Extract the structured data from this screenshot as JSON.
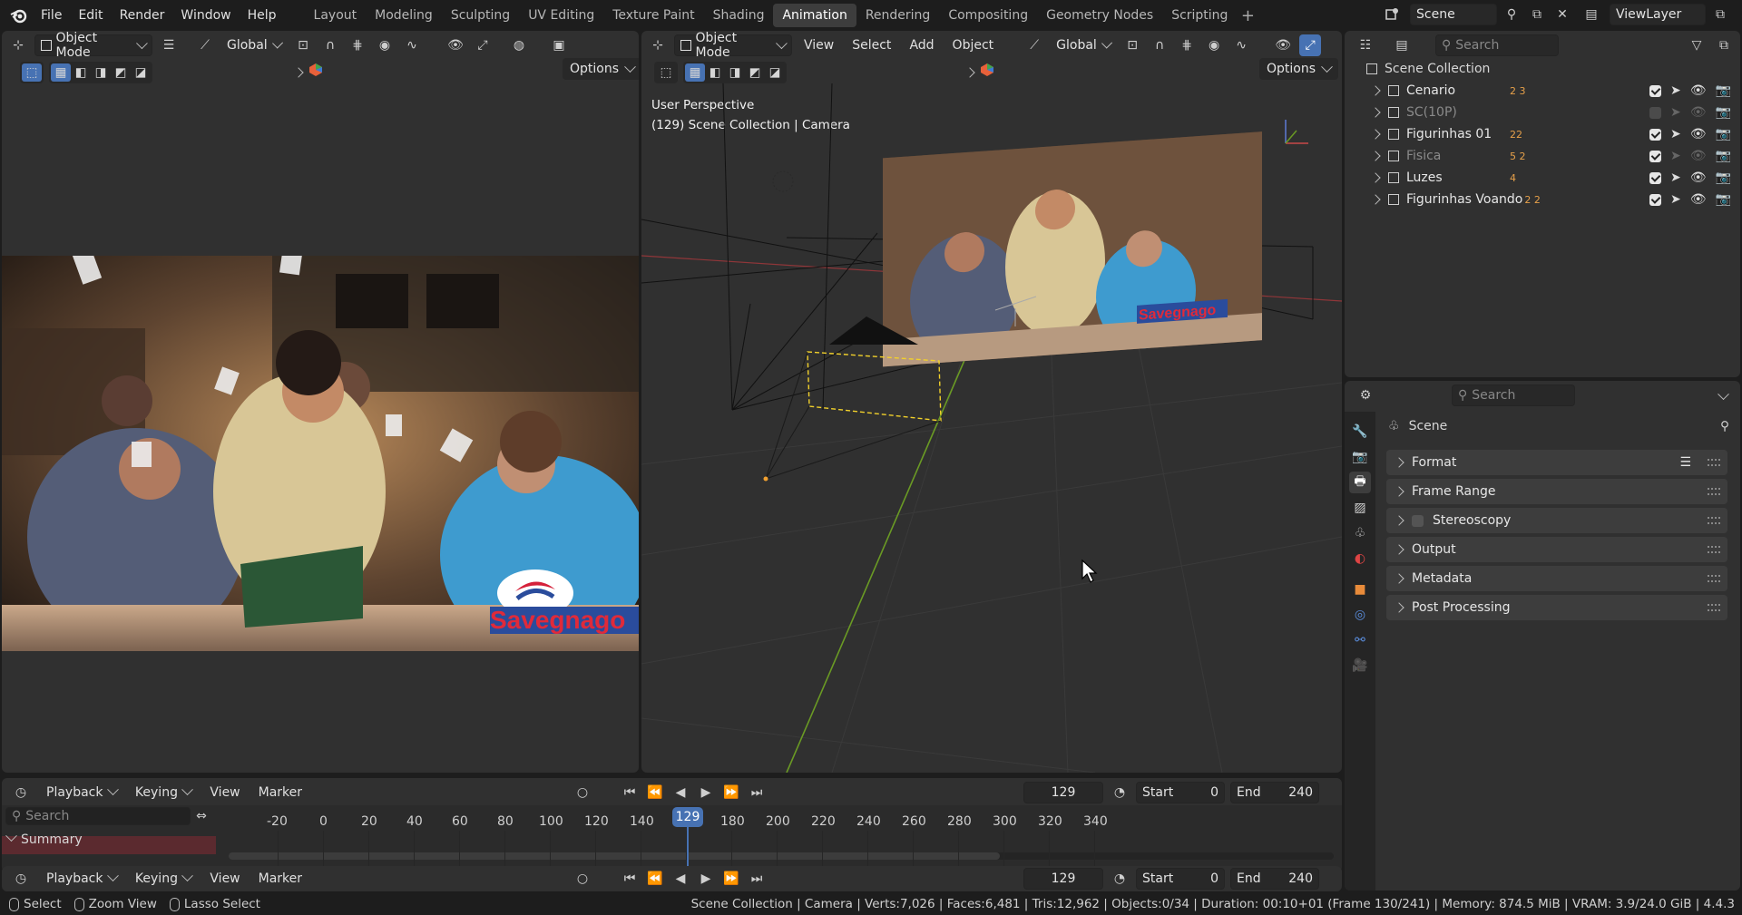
{
  "top_menu": [
    "File",
    "Edit",
    "Render",
    "Window",
    "Help"
  ],
  "workspaces": [
    "Layout",
    "Modeling",
    "Sculpting",
    "UV Editing",
    "Texture Paint",
    "Shading",
    "Animation",
    "Rendering",
    "Compositing",
    "Geometry Nodes",
    "Scripting"
  ],
  "active_workspace": "Animation",
  "scene_name": "Scene",
  "view_layer": "ViewLayer",
  "left_viewport": {
    "mode": "Object Mode",
    "orientation": "Global",
    "options_label": "Options",
    "watermark": "Savegnago"
  },
  "main_viewport": {
    "mode": "Object Mode",
    "menus": [
      "View",
      "Select",
      "Add",
      "Object"
    ],
    "orientation": "Global",
    "options_label": "Options",
    "overlay_line1": "User Perspective",
    "overlay_line2": "(129) Scene Collection | Camera",
    "watermark": "Savegnago"
  },
  "outliner": {
    "search_placeholder": "Search",
    "root": "Scene Collection",
    "items": [
      {
        "name": "Cenario",
        "badge": "2 3",
        "enabled": true,
        "visible": true
      },
      {
        "name": "SC(10P)",
        "badge": "",
        "enabled": false,
        "visible": false
      },
      {
        "name": "Figurinhas 01",
        "badge": "22",
        "enabled": true,
        "visible": true
      },
      {
        "name": "Fisica",
        "badge": "5 2",
        "enabled": true,
        "visible": false
      },
      {
        "name": "Luzes",
        "badge": "4",
        "enabled": true,
        "visible": true
      },
      {
        "name": "Figurinhas Voando",
        "badge": "2 2",
        "enabled": true,
        "visible": true
      }
    ]
  },
  "properties": {
    "search_placeholder": "Search",
    "context": "Scene",
    "panels": [
      "Format",
      "Frame Range",
      "Stereoscopy",
      "Output",
      "Metadata",
      "Post Processing"
    ]
  },
  "timeline": {
    "menus": [
      "Playback",
      "Keying",
      "View",
      "Marker"
    ],
    "current_frame": "129",
    "start_label": "Start",
    "start": "0",
    "end_label": "End",
    "end": "240",
    "search_placeholder": "Search",
    "channel": "Summary",
    "ticks": [
      "-20",
      "0",
      "20",
      "40",
      "60",
      "80",
      "100",
      "120",
      "140",
      "160",
      "180",
      "200",
      "220",
      "240",
      "260",
      "280",
      "300",
      "320",
      "340"
    ]
  },
  "status_bar": {
    "select": "Select",
    "zoom": "Zoom View",
    "lasso": "Lasso Select",
    "stats": "Scene Collection | Camera | Verts:7,026 | Faces:6,481 | Tris:12,962 | Objects:0/34 | Duration: 00:10+01 (Frame 130/241) | Memory: 874.5 MiB | VRAM: 3.9/24.0 GiB | 4.4.3"
  },
  "colors": {
    "accent": "#4772b3",
    "frame_indicator": "#4772b3",
    "x_axis": "#a8383c",
    "y_axis": "#6a9a24",
    "selection": "#f2d12b"
  }
}
